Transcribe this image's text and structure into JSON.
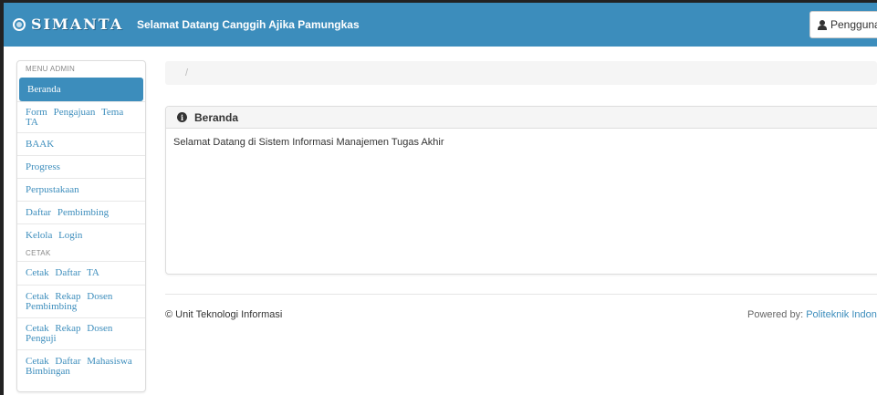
{
  "navbar": {
    "brand": "SIMANTA",
    "welcome": "Selamat Datang Canggih Ajika Pamungkas",
    "user_label": "Pengguna"
  },
  "sidebar": {
    "admin_header": "MENU ADMIN",
    "items": [
      {
        "label": "Beranda"
      },
      {
        "label": "Form Pengajuan Tema TA"
      },
      {
        "label": "BAAK"
      },
      {
        "label": "Progress"
      },
      {
        "label": "Perpustakaan"
      },
      {
        "label": "Daftar Pembimbing"
      },
      {
        "label": "Kelola Login"
      }
    ],
    "cetak_header": "CETAK",
    "cetak_items": [
      {
        "label": "Cetak Daftar TA"
      },
      {
        "label": "Cetak Rekap Dosen Pembimbing"
      },
      {
        "label": "Cetak Rekap Dosen Penguji"
      },
      {
        "label": "Cetak Daftar Mahasiswa Bimbingan"
      }
    ]
  },
  "breadcrumb": {
    "separator": "/"
  },
  "panel": {
    "title": "Beranda",
    "body": "Selamat Datang di Sistem Informasi Manajemen Tugas Akhir"
  },
  "footer": {
    "left": "© Unit Teknologi Informasi",
    "powered_prefix": "Powered by: ",
    "powered_link": "Politeknik Indonusa"
  },
  "colors": {
    "primary": "#3c8dbc"
  }
}
